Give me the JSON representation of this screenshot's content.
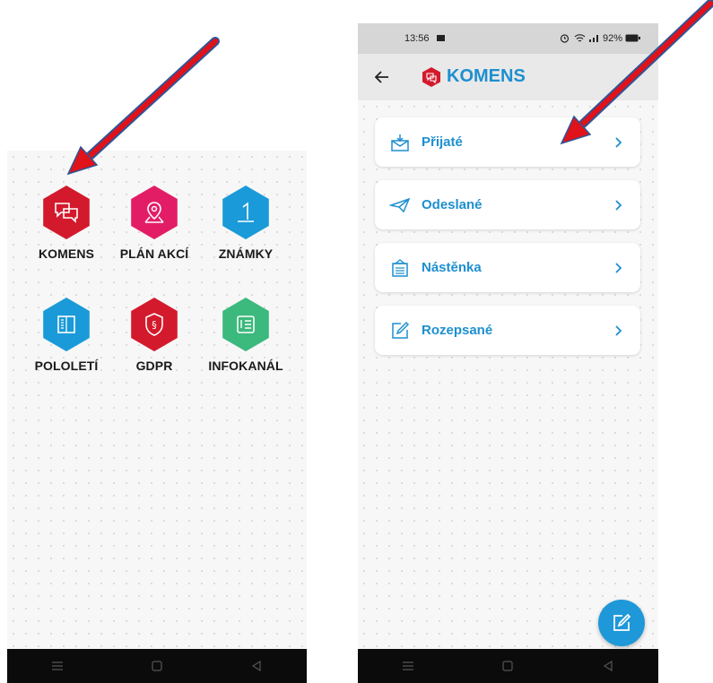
{
  "left_screen": {
    "tiles": [
      {
        "label": "KOMENS",
        "icon": "chat-bubbles-icon",
        "color": "#d31a2c"
      },
      {
        "label": "PLÁN AKCÍ",
        "icon": "map-pin-icon",
        "color": "#e31c66"
      },
      {
        "label": "ZNÁMKY",
        "icon": "grade-one-icon",
        "color": "#1a9ad8"
      },
      {
        "label": "POLOLETÍ",
        "icon": "book-icon",
        "color": "#1a9ad8"
      },
      {
        "label": "GDPR",
        "icon": "shield-paragraph-icon",
        "color": "#d31a2c"
      },
      {
        "label": "INFOKANÁL",
        "icon": "info-list-icon",
        "color": "#3cb97c"
      }
    ]
  },
  "right_screen": {
    "status_bar": {
      "time": "13:56",
      "battery": "92%"
    },
    "app_bar": {
      "title": "KOMENS",
      "back_icon": "back-arrow-icon",
      "logo_icon": "komens-logo-icon"
    },
    "menu": [
      {
        "label": "Přijaté",
        "icon": "inbox-icon"
      },
      {
        "label": "Odeslané",
        "icon": "paper-plane-icon"
      },
      {
        "label": "Nástěnka",
        "icon": "noticeboard-icon"
      },
      {
        "label": "Rozepsané",
        "icon": "draft-edit-icon"
      }
    ],
    "fab_icon": "compose-icon"
  },
  "colors": {
    "accent": "#1d8fd0",
    "brand_red": "#d31a2c",
    "annotation_arrow": "#e0121a"
  }
}
